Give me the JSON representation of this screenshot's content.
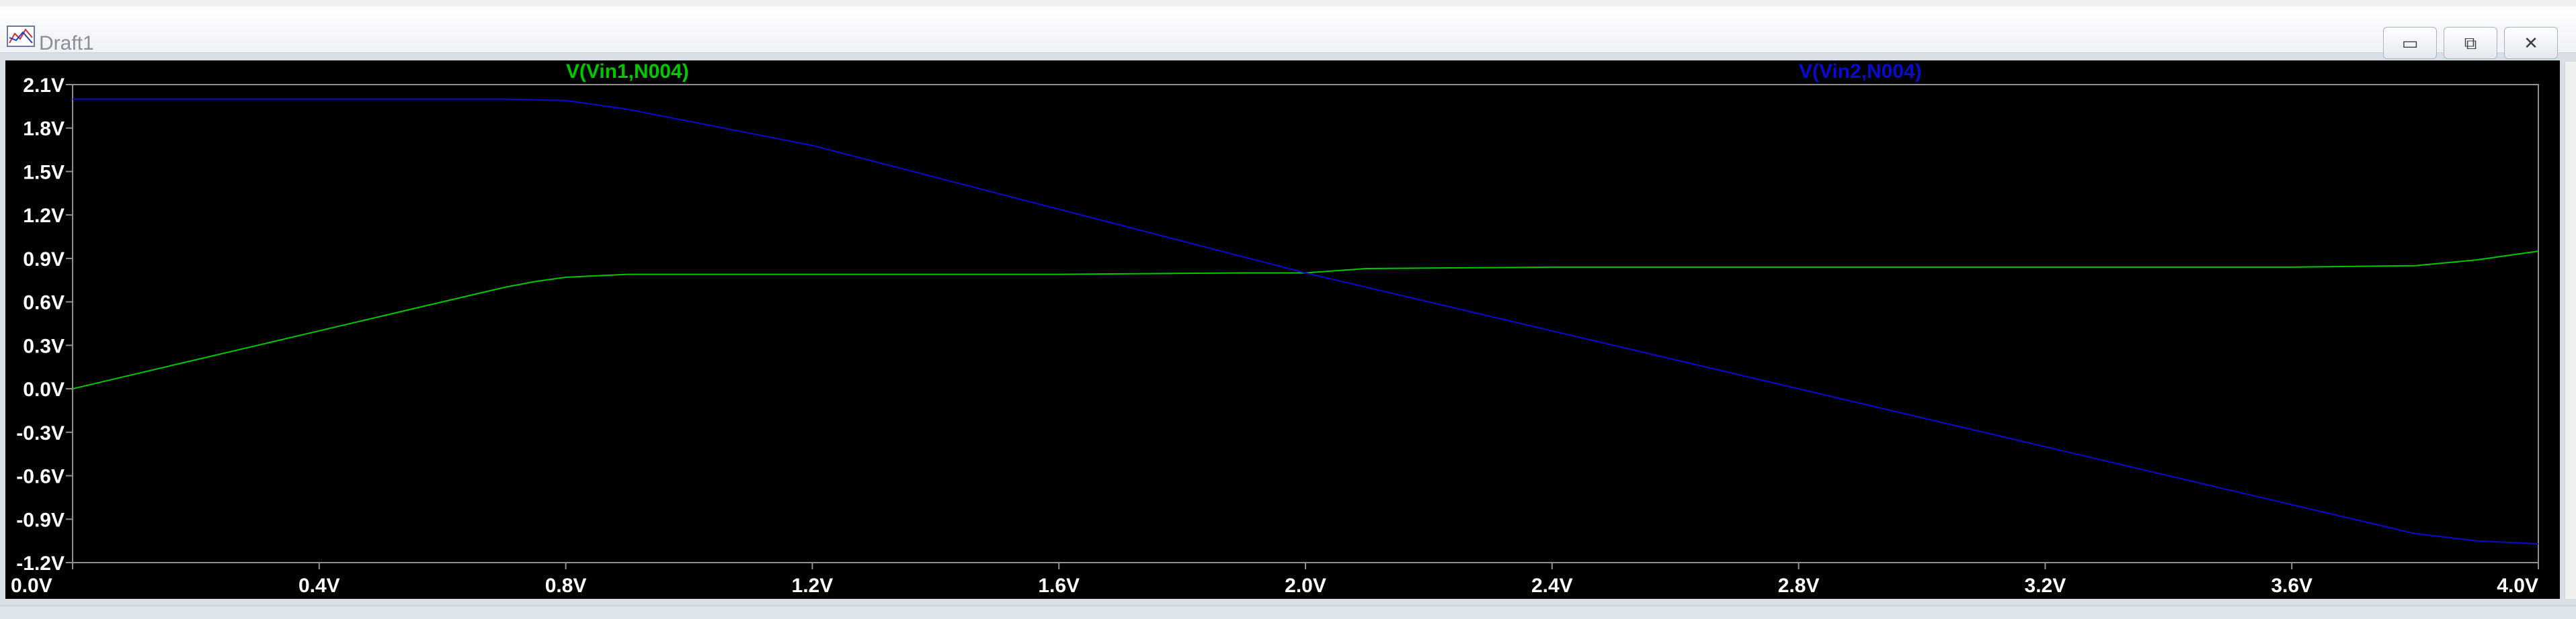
{
  "window": {
    "title": "Draft1",
    "controls": {
      "minimize": "▭",
      "maximize": "⧉",
      "close": "✕"
    }
  },
  "colors": {
    "series1": "#00c800",
    "series2": "#0a0ad0",
    "axis": "#909090",
    "tick_text": "#ffffff",
    "background": "#000000"
  },
  "chart_data": {
    "type": "line",
    "xlim": [
      0.0,
      4.0
    ],
    "ylim": [
      -1.2,
      2.1
    ],
    "x_ticks": [
      "0.0V",
      "0.4V",
      "0.8V",
      "1.2V",
      "1.6V",
      "2.0V",
      "2.4V",
      "2.8V",
      "3.2V",
      "3.6V",
      "4.0V"
    ],
    "y_ticks": [
      "2.1V",
      "1.8V",
      "1.5V",
      "1.2V",
      "0.9V",
      "0.6V",
      "0.3V",
      "0.0V",
      "-0.3V",
      "-0.6V",
      "-0.9V",
      "-1.2V"
    ],
    "grid": false,
    "series": [
      {
        "name": "V(Vin1,N004)",
        "x": [
          0.0,
          0.2,
          0.4,
          0.6,
          0.7,
          0.75,
          0.8,
          0.9,
          1.2,
          1.6,
          1.9,
          2.0,
          2.1,
          2.4,
          2.8,
          3.2,
          3.6,
          3.8,
          3.9,
          4.0
        ],
        "y": [
          0.0,
          0.2,
          0.4,
          0.6,
          0.7,
          0.74,
          0.77,
          0.79,
          0.79,
          0.79,
          0.8,
          0.8,
          0.83,
          0.84,
          0.84,
          0.84,
          0.84,
          0.85,
          0.89,
          0.95
        ]
      },
      {
        "name": "V(Vin2,N004)",
        "x": [
          0.0,
          0.4,
          0.7,
          0.8,
          0.9,
          1.2,
          1.6,
          2.0,
          2.4,
          2.8,
          3.2,
          3.6,
          3.8,
          3.9,
          4.0
        ],
        "y": [
          2.0,
          2.0,
          2.0,
          1.99,
          1.93,
          1.68,
          1.24,
          0.8,
          0.4,
          0.0,
          -0.4,
          -0.8,
          -1.0,
          -1.05,
          -1.07
        ]
      }
    ]
  }
}
